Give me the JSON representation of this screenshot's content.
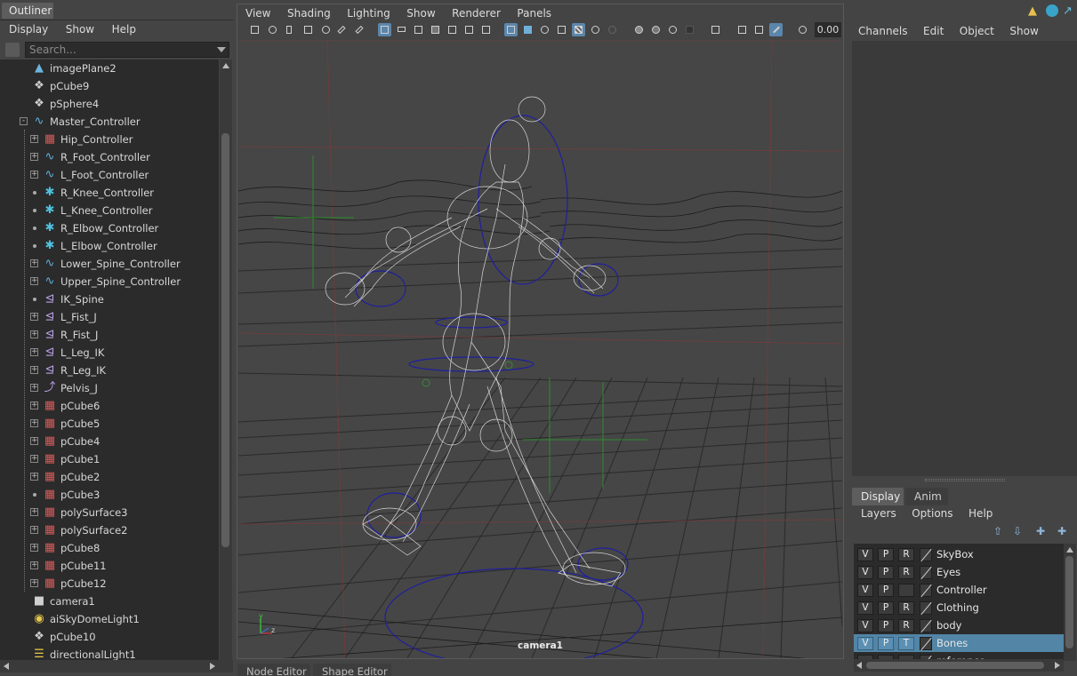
{
  "outliner": {
    "tab": "Outliner",
    "menu": [
      "Display",
      "Show",
      "Help"
    ],
    "search_placeholder": "Search...",
    "items": [
      {
        "label": "imagePlane2",
        "icon": "image-plane-icon",
        "level": 0,
        "control": "none"
      },
      {
        "label": "pCube9",
        "icon": "mesh-icon",
        "level": 0,
        "control": "none"
      },
      {
        "label": "pSphere4",
        "icon": "mesh-icon",
        "level": 0,
        "control": "none"
      },
      {
        "label": "Master_Controller",
        "icon": "curve-icon",
        "level": 0,
        "control": "collapse"
      },
      {
        "label": "Hip_Controller",
        "icon": "nurbs-icon",
        "level": 1,
        "control": "expand"
      },
      {
        "label": "R_Foot_Controller",
        "icon": "curve-icon",
        "level": 1,
        "control": "expand"
      },
      {
        "label": "L_Foot_Controller",
        "icon": "curve-icon",
        "level": 1,
        "control": "expand"
      },
      {
        "label": "R_Knee_Controller",
        "icon": "locator-icon",
        "level": 1,
        "control": "dot"
      },
      {
        "label": "L_Knee_Controller",
        "icon": "locator-icon",
        "level": 1,
        "control": "dot"
      },
      {
        "label": "R_Elbow_Controller",
        "icon": "locator-icon",
        "level": 1,
        "control": "dot"
      },
      {
        "label": "L_Elbow_Controller",
        "icon": "locator-icon",
        "level": 1,
        "control": "dot"
      },
      {
        "label": "Lower_Spine_Controller",
        "icon": "curve-icon",
        "level": 1,
        "control": "expand"
      },
      {
        "label": "Upper_Spine_Controller",
        "icon": "curve-icon",
        "level": 1,
        "control": "expand"
      },
      {
        "label": "IK_Spine",
        "icon": "ik-handle-icon",
        "level": 1,
        "control": "dot"
      },
      {
        "label": "L_Fist_J",
        "icon": "ik-handle-icon",
        "level": 1,
        "control": "expand"
      },
      {
        "label": "R_Fist_J",
        "icon": "ik-handle-icon",
        "level": 1,
        "control": "expand"
      },
      {
        "label": "L_Leg_IK",
        "icon": "ik-handle-icon",
        "level": 1,
        "control": "expand"
      },
      {
        "label": "R_Leg_IK",
        "icon": "ik-handle-icon",
        "level": 1,
        "control": "expand"
      },
      {
        "label": "Pelvis_J",
        "icon": "joint-icon",
        "level": 1,
        "control": "expand"
      },
      {
        "label": "pCube6",
        "icon": "nurbs-icon",
        "level": 1,
        "control": "expand"
      },
      {
        "label": "pCube5",
        "icon": "nurbs-icon",
        "level": 1,
        "control": "expand"
      },
      {
        "label": "pCube4",
        "icon": "nurbs-icon",
        "level": 1,
        "control": "expand"
      },
      {
        "label": "pCube1",
        "icon": "nurbs-icon",
        "level": 1,
        "control": "expand"
      },
      {
        "label": "pCube2",
        "icon": "nurbs-icon",
        "level": 1,
        "control": "expand"
      },
      {
        "label": "pCube3",
        "icon": "nurbs-icon",
        "level": 1,
        "control": "dot"
      },
      {
        "label": "polySurface3",
        "icon": "nurbs-icon",
        "level": 1,
        "control": "expand"
      },
      {
        "label": "polySurface2",
        "icon": "nurbs-icon",
        "level": 1,
        "control": "expand"
      },
      {
        "label": "pCube8",
        "icon": "nurbs-icon",
        "level": 1,
        "control": "expand"
      },
      {
        "label": "pCube11",
        "icon": "nurbs-icon",
        "level": 1,
        "control": "expand"
      },
      {
        "label": "pCube12",
        "icon": "nurbs-icon",
        "level": 1,
        "control": "expand"
      },
      {
        "label": "camera1",
        "icon": "camera-icon",
        "level": 0,
        "control": "none"
      },
      {
        "label": "aiSkyDomeLight1",
        "icon": "sky-dome-light-icon",
        "level": 0,
        "control": "none"
      },
      {
        "label": "pCube10",
        "icon": "mesh-icon",
        "level": 0,
        "control": "none"
      },
      {
        "label": "directionalLight1",
        "icon": "directional-light-icon",
        "level": 0,
        "control": "none"
      }
    ]
  },
  "viewport": {
    "menu": [
      "View",
      "Shading",
      "Lighting",
      "Show",
      "Renderer",
      "Panels"
    ],
    "field_value": "0.00",
    "camera_label": "camera1"
  },
  "bottom_tabs": [
    "Node Editor",
    "Shape Editor"
  ],
  "channel_box": {
    "menu": [
      "Channels",
      "Edit",
      "Object",
      "Show"
    ]
  },
  "layer_editor": {
    "tabs": [
      "Display",
      "Anim"
    ],
    "menu": [
      "Layers",
      "Options",
      "Help"
    ],
    "layers": [
      {
        "v": "V",
        "p": "P",
        "r": "R",
        "name": "SkyBox",
        "selected": false
      },
      {
        "v": "V",
        "p": "P",
        "r": "R",
        "name": "Eyes",
        "selected": false
      },
      {
        "v": "V",
        "p": "P",
        "r": "",
        "name": "Controller",
        "selected": false
      },
      {
        "v": "V",
        "p": "P",
        "r": "R",
        "name": "Clothing",
        "selected": false
      },
      {
        "v": "V",
        "p": "P",
        "r": "R",
        "name": "body",
        "selected": false
      },
      {
        "v": "V",
        "p": "P",
        "r": "T",
        "name": "Bones",
        "selected": true
      },
      {
        "v": "",
        "p": "",
        "r": "",
        "name": "reference",
        "selected": false
      }
    ]
  },
  "colors": {
    "panel_bg": "#444444",
    "list_bg": "#2b2b2b",
    "selection": "#5285a6",
    "accent_blue": "#5b86ab"
  }
}
